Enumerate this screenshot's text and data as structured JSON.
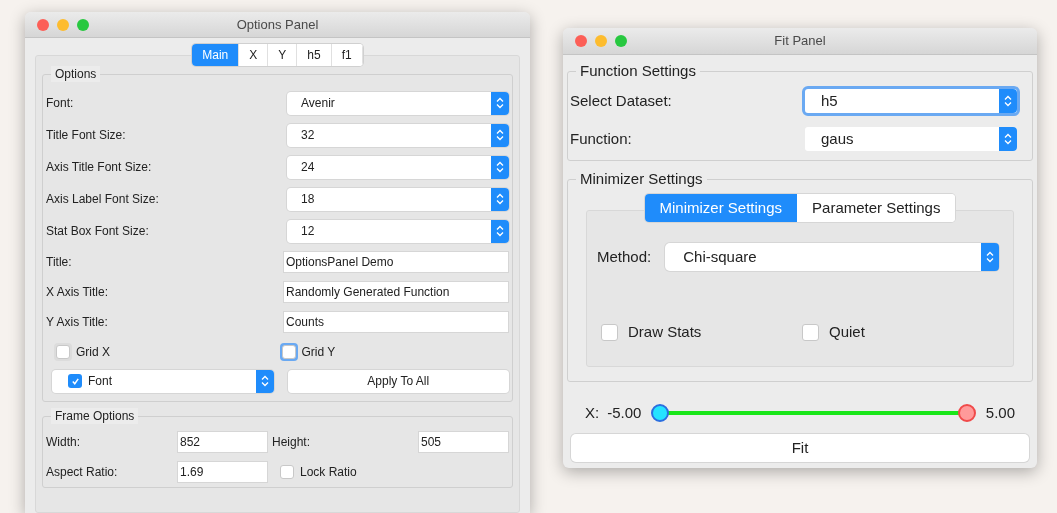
{
  "options_panel": {
    "title": "Options Panel",
    "tabs": [
      {
        "label": "Main",
        "selected": true
      },
      {
        "label": "X",
        "selected": false
      },
      {
        "label": "Y",
        "selected": false
      },
      {
        "label": "h5",
        "selected": false
      },
      {
        "label": "f1",
        "selected": false
      }
    ],
    "options": {
      "title": "Options",
      "combos": [
        {
          "label": "Font:",
          "value": "Avenir"
        },
        {
          "label": "Title Font Size:",
          "value": "32"
        },
        {
          "label": "Axis Title Font Size:",
          "value": "24"
        },
        {
          "label": "Axis Label Font Size:",
          "value": "18"
        },
        {
          "label": "Stat Box Font Size:",
          "value": "12"
        }
      ],
      "text_fields": [
        {
          "label": "Title:",
          "value": "OptionsPanel Demo"
        },
        {
          "label": "X Axis Title:",
          "value": "Randomly Generated Function"
        },
        {
          "label": "Y Axis Title:",
          "value": "Counts"
        }
      ],
      "checkboxes": [
        {
          "label": "Grid X",
          "checked": false,
          "focused": false
        },
        {
          "label": "Grid Y",
          "checked": false,
          "focused": true
        }
      ],
      "font_combo": {
        "label": "Font",
        "checked": true
      },
      "apply_button": "Apply To All"
    },
    "frame_options": {
      "title": "Frame Options",
      "width": {
        "label": "Width:",
        "value": "852"
      },
      "height": {
        "label": "Height:",
        "value": "505"
      },
      "aspect_ratio": {
        "label": "Aspect Ratio:",
        "value": "1.69"
      },
      "lock_ratio": {
        "label": "Lock Ratio",
        "checked": false
      }
    }
  },
  "fit_panel": {
    "title": "Fit Panel",
    "function_settings": {
      "title": "Function Settings",
      "fields": [
        {
          "label": "Select Dataset:",
          "value": "h5",
          "focused": true
        },
        {
          "label": "Function:",
          "value": "gaus",
          "focused": false
        }
      ]
    },
    "minimizer_settings": {
      "title": "Minimizer Settings",
      "tabs": [
        {
          "label": "Minimizer Settings",
          "selected": true
        },
        {
          "label": "Parameter Settings",
          "selected": false
        }
      ],
      "method": {
        "label": "Method:",
        "value": "Chi-square"
      },
      "checkboxes": [
        {
          "label": "Draw Stats",
          "checked": false
        },
        {
          "label": "Quiet",
          "checked": false
        }
      ]
    },
    "range": {
      "label": "X:",
      "min": "-5.00",
      "max": "5.00",
      "thumbs": [
        {
          "level": 0
        },
        {
          "level": 1
        }
      ]
    },
    "fit_button": "Fit"
  }
}
